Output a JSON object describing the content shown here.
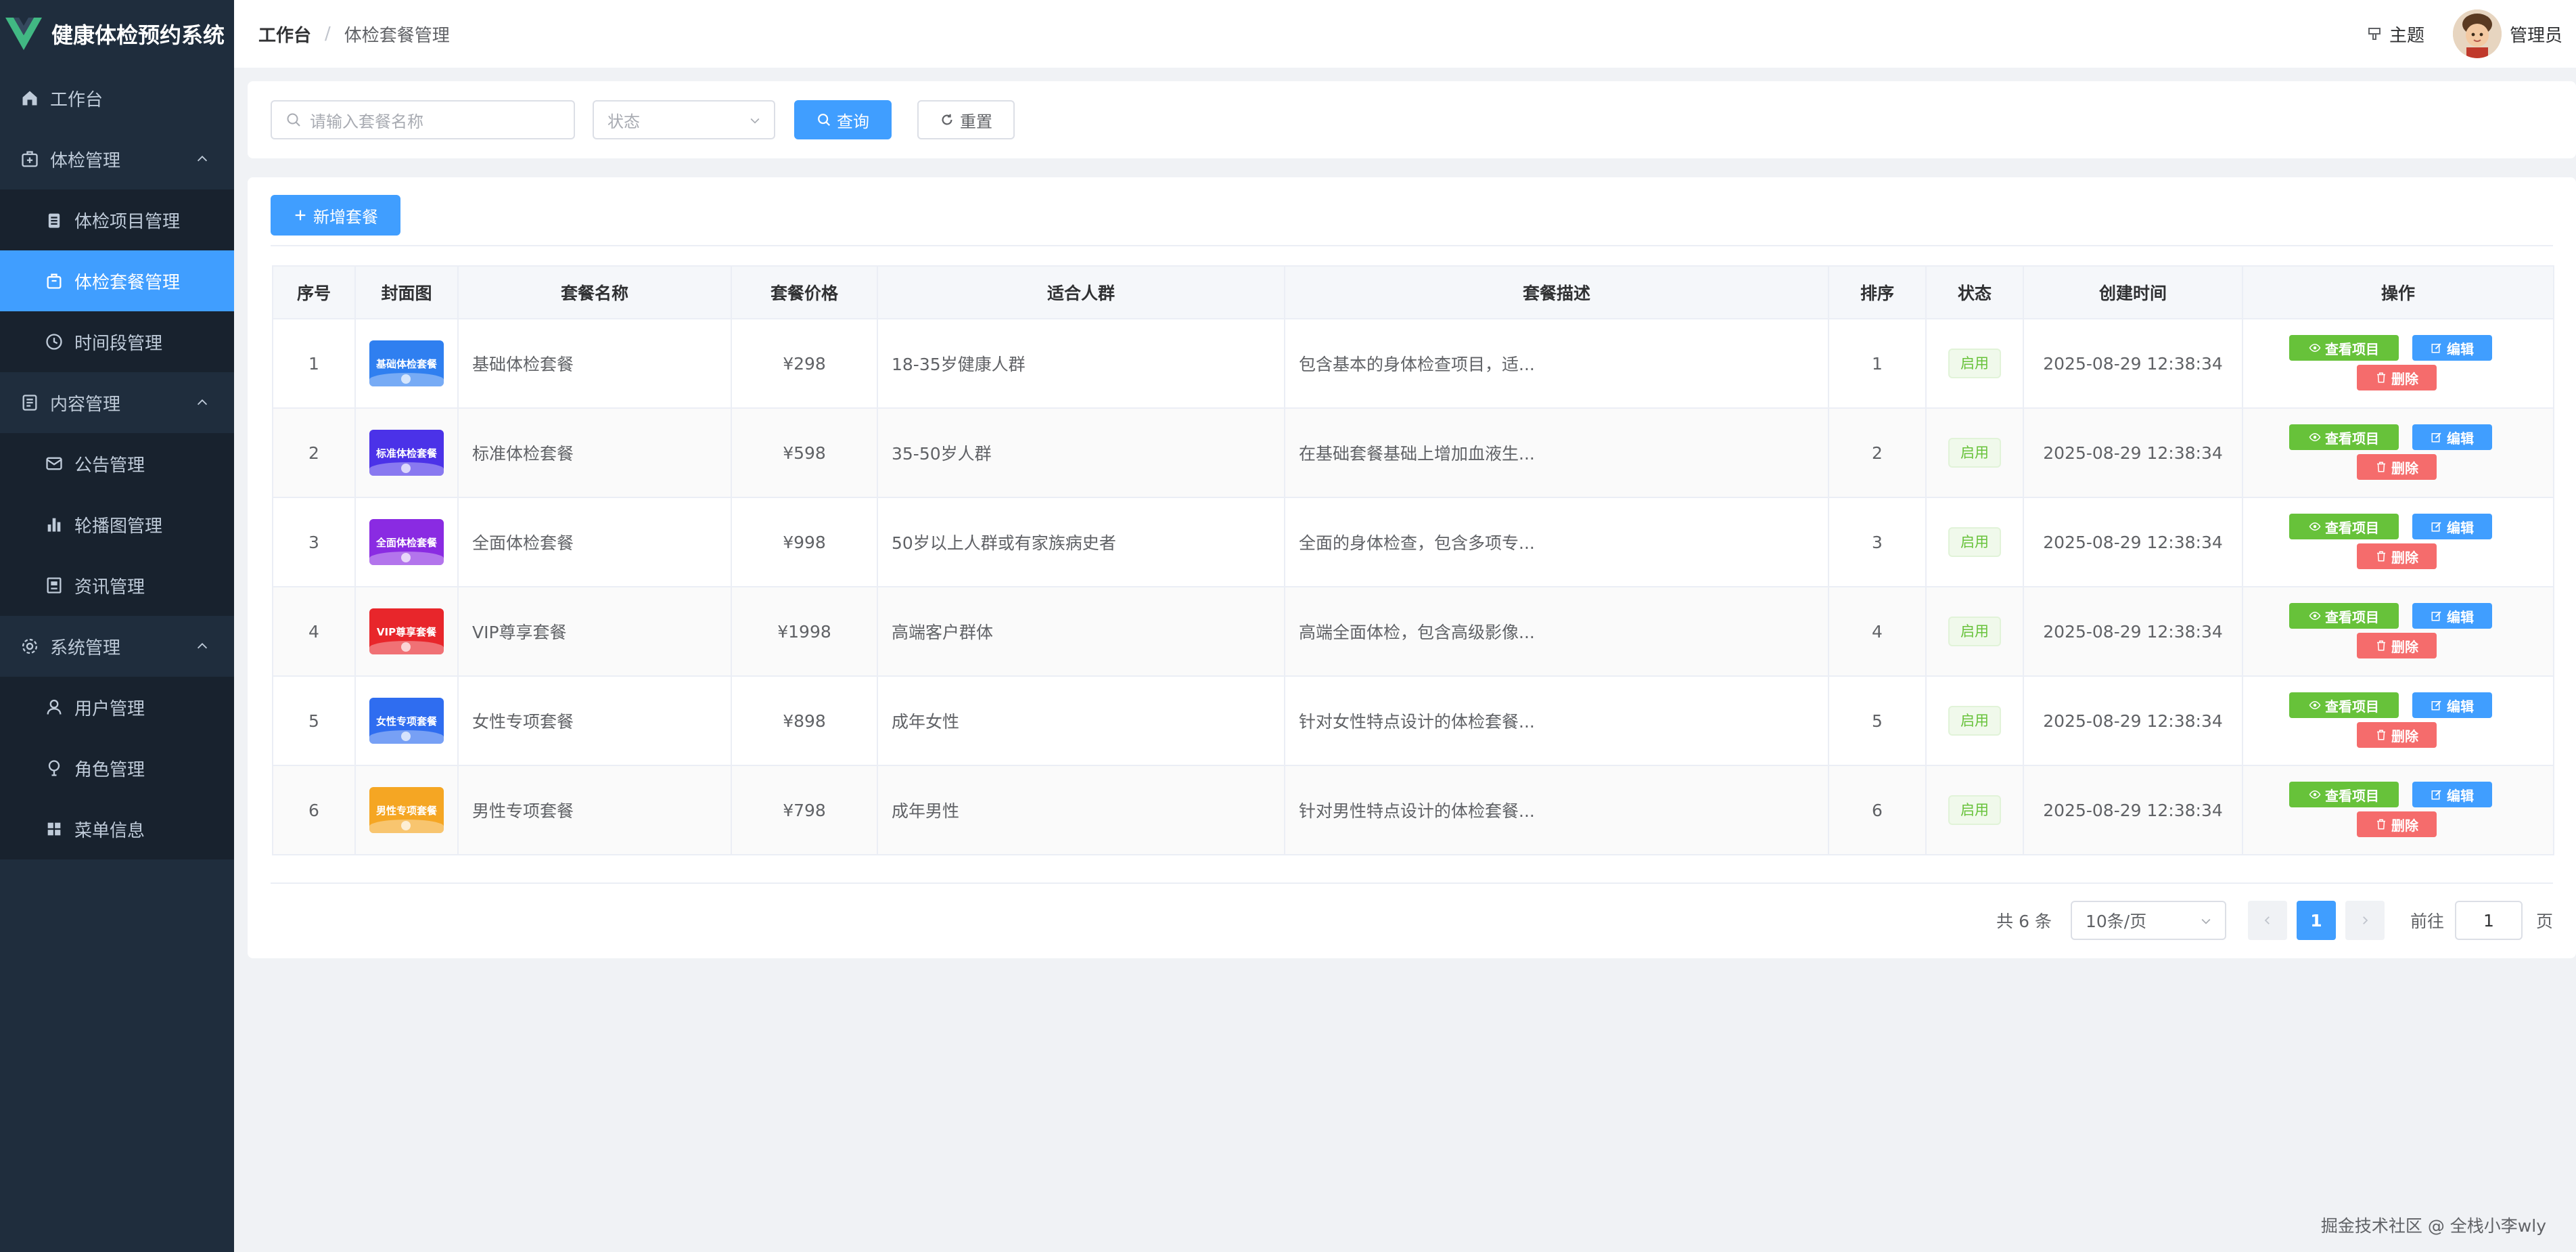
{
  "app": {
    "title": "健康体检预约系统"
  },
  "colors": {
    "primary": "#409eff",
    "sidebar_bg": "#1f2d3d",
    "success": "#67c23a",
    "danger": "#f56c6c"
  },
  "sidebar": {
    "items": [
      {
        "label": "工作台",
        "icon": "home-icon"
      },
      {
        "label": "体检管理",
        "icon": "medical-kit-icon",
        "children": [
          {
            "label": "体检项目管理",
            "icon": "clipboard-icon"
          },
          {
            "label": "体检套餐管理",
            "icon": "package-icon",
            "active": true
          },
          {
            "label": "时间段管理",
            "icon": "clock-icon"
          }
        ]
      },
      {
        "label": "内容管理",
        "icon": "document-icon",
        "children": [
          {
            "label": "公告管理",
            "icon": "mail-icon"
          },
          {
            "label": "轮播图管理",
            "icon": "bar-chart-icon"
          },
          {
            "label": "资讯管理",
            "icon": "news-icon"
          }
        ]
      },
      {
        "label": "系统管理",
        "icon": "gear-icon",
        "children": [
          {
            "label": "用户管理",
            "icon": "user-icon"
          },
          {
            "label": "角色管理",
            "icon": "bulb-icon"
          },
          {
            "label": "菜单信息",
            "icon": "grid-icon"
          }
        ]
      }
    ]
  },
  "header": {
    "breadcrumb": [
      "工作台",
      "体检套餐管理"
    ],
    "separator": "/",
    "theme_label": "主题",
    "user_name": "管理员"
  },
  "search": {
    "name_placeholder": "请输入套餐名称",
    "status_placeholder": "状态",
    "query_label": "查询",
    "reset_label": "重置"
  },
  "toolbar": {
    "add_label": "新增套餐"
  },
  "table": {
    "columns": [
      "序号",
      "封面图",
      "套餐名称",
      "套餐价格",
      "适合人群",
      "套餐描述",
      "排序",
      "状态",
      "创建时间",
      "操作"
    ],
    "rows": [
      {
        "no": "1",
        "cover_text": "基础体检套餐",
        "cover_color": "#2f7ff0",
        "name": "基础体检套餐",
        "price": "¥298",
        "crowd": "18-35岁健康人群",
        "desc": "包含基本的身体检查项目，适...",
        "sort": "1",
        "status": "启用",
        "created": "2025-08-29 12:38:34"
      },
      {
        "no": "2",
        "cover_text": "标准体检套餐",
        "cover_color": "#4b32e8",
        "name": "标准体检套餐",
        "price": "¥598",
        "crowd": "35-50岁人群",
        "desc": "在基础套餐基础上增加血液生...",
        "sort": "2",
        "status": "启用",
        "created": "2025-08-29 12:38:34"
      },
      {
        "no": "3",
        "cover_text": "全面体检套餐",
        "cover_color": "#8a2be2",
        "name": "全面体检套餐",
        "price": "¥998",
        "crowd": "50岁以上人群或有家族病史者",
        "desc": "全面的身体检查，包含多项专...",
        "sort": "3",
        "status": "启用",
        "created": "2025-08-29 12:38:34"
      },
      {
        "no": "4",
        "cover_text": "VIP尊享套餐",
        "cover_color": "#e8262b",
        "name": "VIP尊享套餐",
        "price": "¥1998",
        "crowd": "高端客户群体",
        "desc": "高端全面体检，包含高级影像...",
        "sort": "4",
        "status": "启用",
        "created": "2025-08-29 12:38:34"
      },
      {
        "no": "5",
        "cover_text": "女性专项套餐",
        "cover_color": "#2f6df0",
        "name": "女性专项套餐",
        "price": "¥898",
        "crowd": "成年女性",
        "desc": "针对女性特点设计的体检套餐...",
        "sort": "5",
        "status": "启用",
        "created": "2025-08-29 12:38:34"
      },
      {
        "no": "6",
        "cover_text": "男性专项套餐",
        "cover_color": "#f5a623",
        "name": "男性专项套餐",
        "price": "¥798",
        "crowd": "成年男性",
        "desc": "针对男性特点设计的体检套餐...",
        "sort": "6",
        "status": "启用",
        "created": "2025-08-29 12:38:34"
      }
    ],
    "actions": {
      "view": "查看项目",
      "edit": "编辑",
      "delete": "删除"
    }
  },
  "pagination": {
    "total": "共 6 条",
    "page_size": "10条/页",
    "current_page": "1",
    "goto_label": "前往",
    "goto_value": "1",
    "page_suffix": "页"
  },
  "watermark": "掘金技术社区 @ 全栈小李wly"
}
